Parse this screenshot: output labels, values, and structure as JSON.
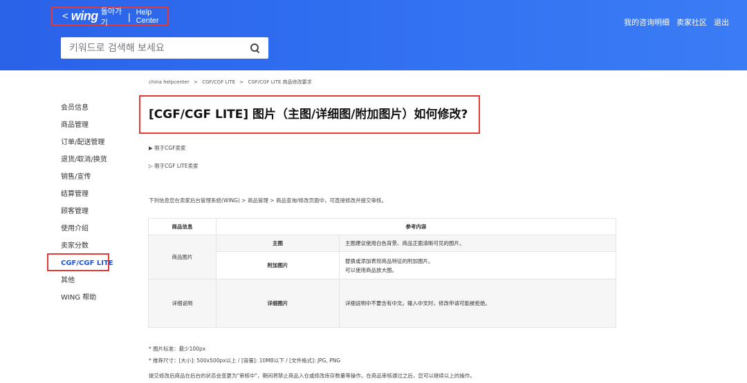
{
  "header": {
    "back_arrow": "<",
    "logo": "wing",
    "back_label": "돌아가기",
    "separator": "|",
    "help_center": "Help Center",
    "search_placeholder": "키워드로 검색해 보세요",
    "nav": [
      "我的咨询明细",
      "卖家社区",
      "退出"
    ]
  },
  "sidebar": {
    "items": [
      "会员信息",
      "商品管理",
      "订单/配送管理",
      "退货/取消/换货",
      "销售/宣传",
      "结算管理",
      "顾客管理",
      "使用介绍",
      "卖家分数",
      "CGF/CGF LITE",
      "其他",
      "WING 帮助"
    ]
  },
  "breadcrumb": [
    "china helpcenter",
    ">",
    "CGF/CGF LITE",
    ">",
    "CGF/CGF LITE 商品修改要求"
  ],
  "title": "[CGF/CGF LITE] 图片（主图/详细图/附加图片）如何修改?",
  "toggles": [
    "▶ 限于CGF卖家",
    "▷ 限于CGF LITE卖家"
  ],
  "description": "下列信息您在卖家后台管理系统(WING) > 商品管理 > 商品查询/修改页面中，可直接修改并提交审核。",
  "table": {
    "headers": [
      "商品信息",
      "参考内容"
    ],
    "cat_images": "商品图片",
    "cat_detail": "详细说明",
    "main_image": "主图",
    "main_image_desc": "主图建议使用白色背景、商品正面清晰可见的图片。",
    "extra_image": "附加图片",
    "extra_image_desc_1": "替换或添加表现商品特征的附加图片。",
    "extra_image_desc_2": "可以使用商品放大图。",
    "detail_image": "详细图片",
    "detail_image_desc": "详细说明中不要含有中文。输入中文时，修改申请可能被拒绝。"
  },
  "notes": [
    "* 图片标准：最少100px",
    "* 推荐尺寸：[大小]: 500x500px以上 / [容量]: 10MB以下 / [文件格式]: JPG, PNG"
  ],
  "footer_note": "提交修改后商品在后台的状态会变更为\"审核中\"，期间将禁止商品入仓或修改库存数量等操作。在商品审核通过之后，您可以继续以上的操作。"
}
